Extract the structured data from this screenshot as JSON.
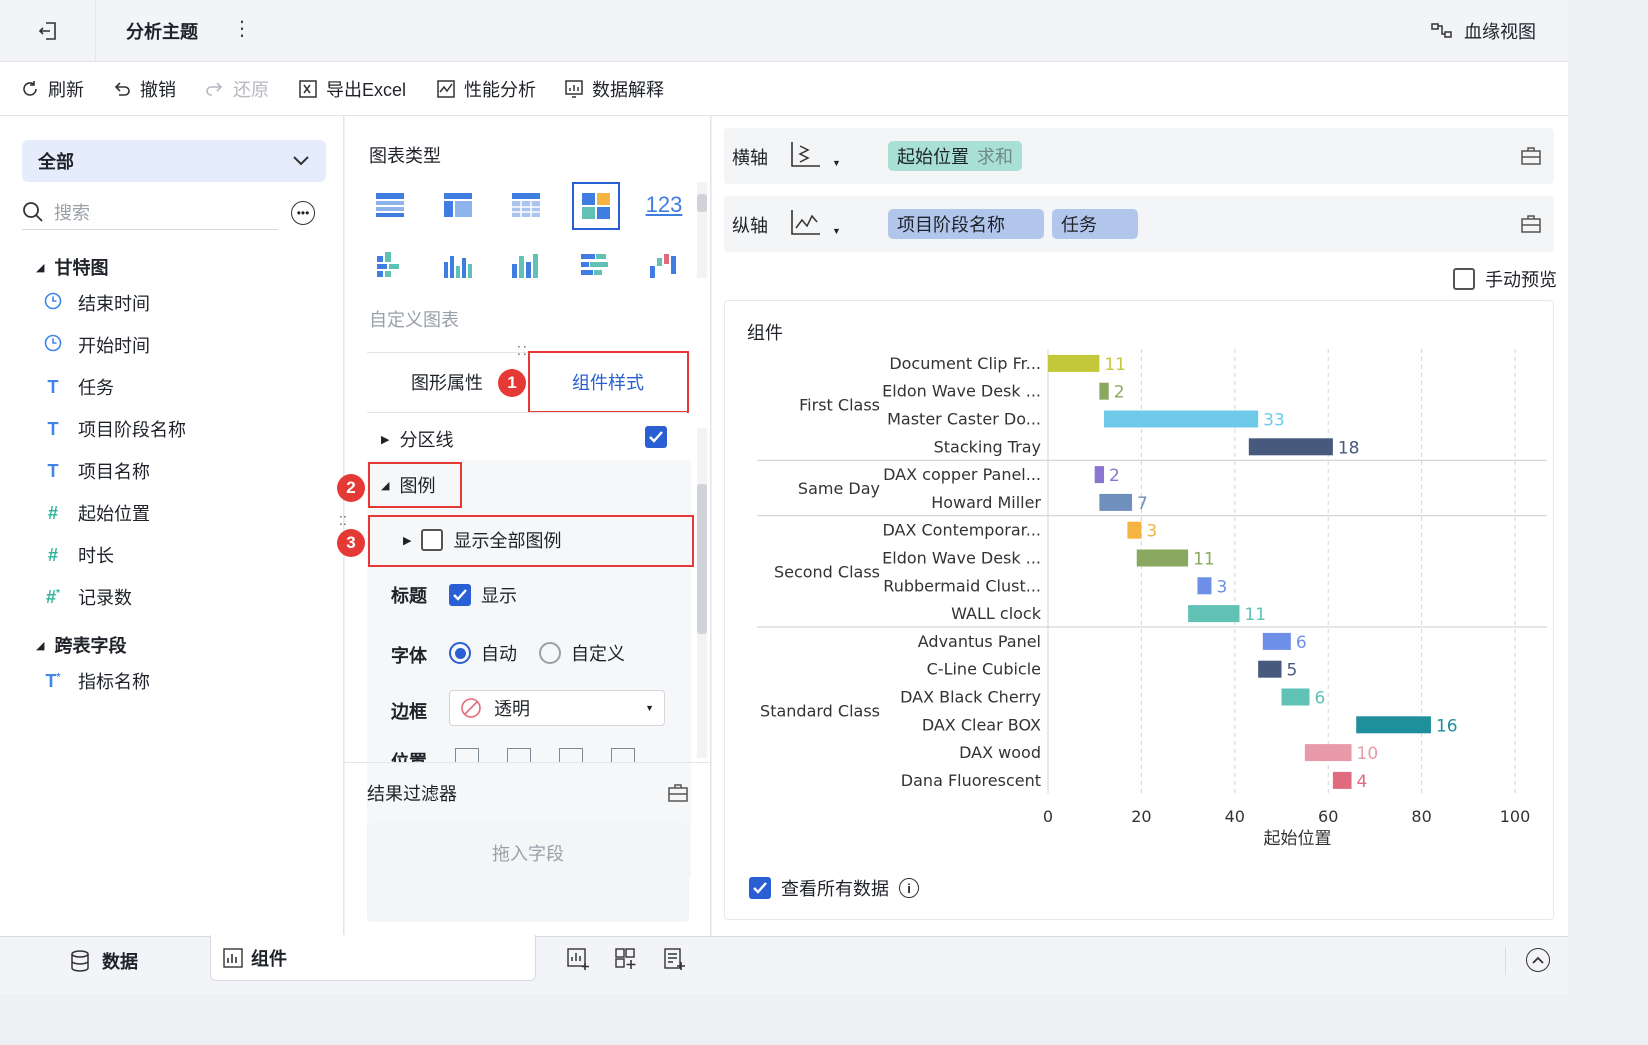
{
  "topbar": {
    "title": "分析主题",
    "lineage": "血缘视图"
  },
  "toolbar": {
    "refresh": "刷新",
    "undo": "撤销",
    "redo": "还原",
    "export": "导出Excel",
    "perf": "性能分析",
    "explain": "数据解释"
  },
  "left": {
    "select_value": "全部",
    "search_placeholder": "搜索",
    "group1": "甘特图",
    "fields": [
      {
        "icon": "clock-icon",
        "label": "结束时间"
      },
      {
        "icon": "clock-icon",
        "label": "开始时间"
      },
      {
        "icon": "text-field-icon",
        "label": "任务"
      },
      {
        "icon": "text-field-icon",
        "label": "项目阶段名称"
      },
      {
        "icon": "text-field-icon",
        "label": "项目名称"
      },
      {
        "icon": "number-field-icon",
        "label": "起始位置"
      },
      {
        "icon": "number-field-icon",
        "label": "时长"
      },
      {
        "icon": "calc-number-icon",
        "label": "记录数"
      }
    ],
    "group2": "跨表字段",
    "fields2": [
      {
        "icon": "calc-text-icon",
        "label": "指标名称"
      }
    ]
  },
  "mid": {
    "chart_type_title": "图表类型",
    "custom_chart": "自定义图表",
    "tab_props": "图形属性",
    "tab_style": "组件样式",
    "partition_line": "分区线",
    "legend": "图例",
    "show_all_legend": "显示全部图例",
    "title_label": "标题",
    "title_show": "显示",
    "font_label": "字体",
    "font_auto": "自动",
    "font_custom": "自定义",
    "border_label": "边框",
    "border_value": "透明",
    "position_label": "位置",
    "filter_title": "结果过滤器",
    "drop_field": "拖入字段",
    "badges": [
      "1",
      "2",
      "3"
    ]
  },
  "right": {
    "x_axis_label": "横轴",
    "y_axis_label": "纵轴",
    "x_pill_field": "起始位置",
    "x_pill_agg": "求和",
    "y_pills": [
      "项目阶段名称",
      "任务"
    ],
    "manual_preview": "手动预览",
    "component_title": "组件",
    "view_all": "查看所有数据"
  },
  "bottom": {
    "data_tab": "数据",
    "component_tab": "组件"
  },
  "chart_data": {
    "type": "bar",
    "orientation": "horizontal",
    "xlabel": "起始位置",
    "xlim": [
      0,
      100
    ],
    "xticks": [
      0,
      20,
      40,
      60,
      80,
      100
    ],
    "grid": true,
    "groups": [
      {
        "name": "First Class",
        "items": [
          {
            "task": "Document Clip Fr...",
            "start": 0,
            "value": 11,
            "color": "#c3c83a"
          },
          {
            "task": "Eldon Wave Desk ...",
            "start": 11,
            "value": 2,
            "color": "#8aa860"
          },
          {
            "task": "Master Caster Do...",
            "start": 12,
            "value": 33,
            "color": "#6fc9e8"
          },
          {
            "task": "Stacking Tray",
            "start": 43,
            "value": 18,
            "color": "#475a7d"
          }
        ]
      },
      {
        "name": "Same Day",
        "items": [
          {
            "task": "DAX copper Panel...",
            "start": 10,
            "value": 2,
            "color": "#8a76d1"
          },
          {
            "task": "Howard Miller",
            "start": 11,
            "value": 7,
            "color": "#6f8fbd"
          }
        ]
      },
      {
        "name": "Second Class",
        "items": [
          {
            "task": "DAX Contemporar...",
            "start": 17,
            "value": 3,
            "color": "#f5b342"
          },
          {
            "task": "Eldon Wave Desk ...",
            "start": 19,
            "value": 11,
            "color": "#8aa860"
          },
          {
            "task": "Rubbermaid Clust...",
            "start": 32,
            "value": 3,
            "color": "#6d8fe8"
          },
          {
            "task": "WALL clock",
            "start": 30,
            "value": 11,
            "color": "#5fc2b5"
          }
        ]
      },
      {
        "name": "Standard Class",
        "items": [
          {
            "task": "Advantus Panel",
            "start": 46,
            "value": 6,
            "color": "#6d8fe8"
          },
          {
            "task": "C-Line Cubicle",
            "start": 45,
            "value": 5,
            "color": "#475a7d"
          },
          {
            "task": "DAX Black Cherry",
            "start": 50,
            "value": 6,
            "color": "#5fc2b5"
          },
          {
            "task": "DAX Clear BOX",
            "start": 66,
            "value": 16,
            "color": "#1f8f9c"
          },
          {
            "task": "DAX wood",
            "start": 55,
            "value": 10,
            "color": "#e89aa8"
          },
          {
            "task": "Dana Fluorescent",
            "start": 61,
            "value": 4,
            "color": "#e06b7e"
          }
        ]
      }
    ]
  }
}
